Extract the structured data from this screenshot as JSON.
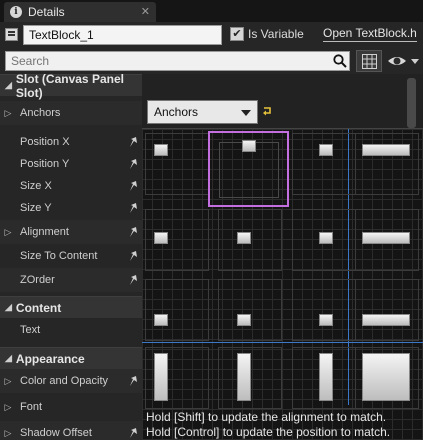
{
  "tab": {
    "title": "Details"
  },
  "header": {
    "name_value": "TextBlock_1",
    "is_variable_label": "Is Variable",
    "is_variable_checked": true,
    "open_link": "Open TextBlock.h"
  },
  "search": {
    "placeholder": "Search"
  },
  "sections": {
    "slot": {
      "title": "Slot (Canvas Panel Slot)",
      "props": [
        "Anchors",
        "Position X",
        "Position Y",
        "Size X",
        "Size Y",
        "Alignment",
        "Size To Content",
        "ZOrder"
      ]
    },
    "content": {
      "title": "Content",
      "props": [
        "Text"
      ]
    },
    "appearance": {
      "title": "Appearance",
      "props": [
        "Color and Opacity",
        "Font",
        "Shadow Offset"
      ]
    }
  },
  "anchors": {
    "dropdown_label": "Anchors",
    "presets": [
      "top-left",
      "top-center",
      "top-right",
      "top-stretch",
      "center-left",
      "center-center",
      "center-right",
      "center-stretch",
      "bottom-left",
      "bottom-center",
      "bottom-right",
      "bottom-stretch",
      "left-stretch",
      "center-vertical-stretch",
      "right-stretch",
      "full-stretch"
    ],
    "selected": "top-center",
    "hint_shift": "Hold [Shift] to update the alignment to match.",
    "hint_control": "Hold [Control] to update the position to match."
  },
  "colors": {
    "selection": "#c46fe0",
    "guide": "#3c78c8"
  }
}
